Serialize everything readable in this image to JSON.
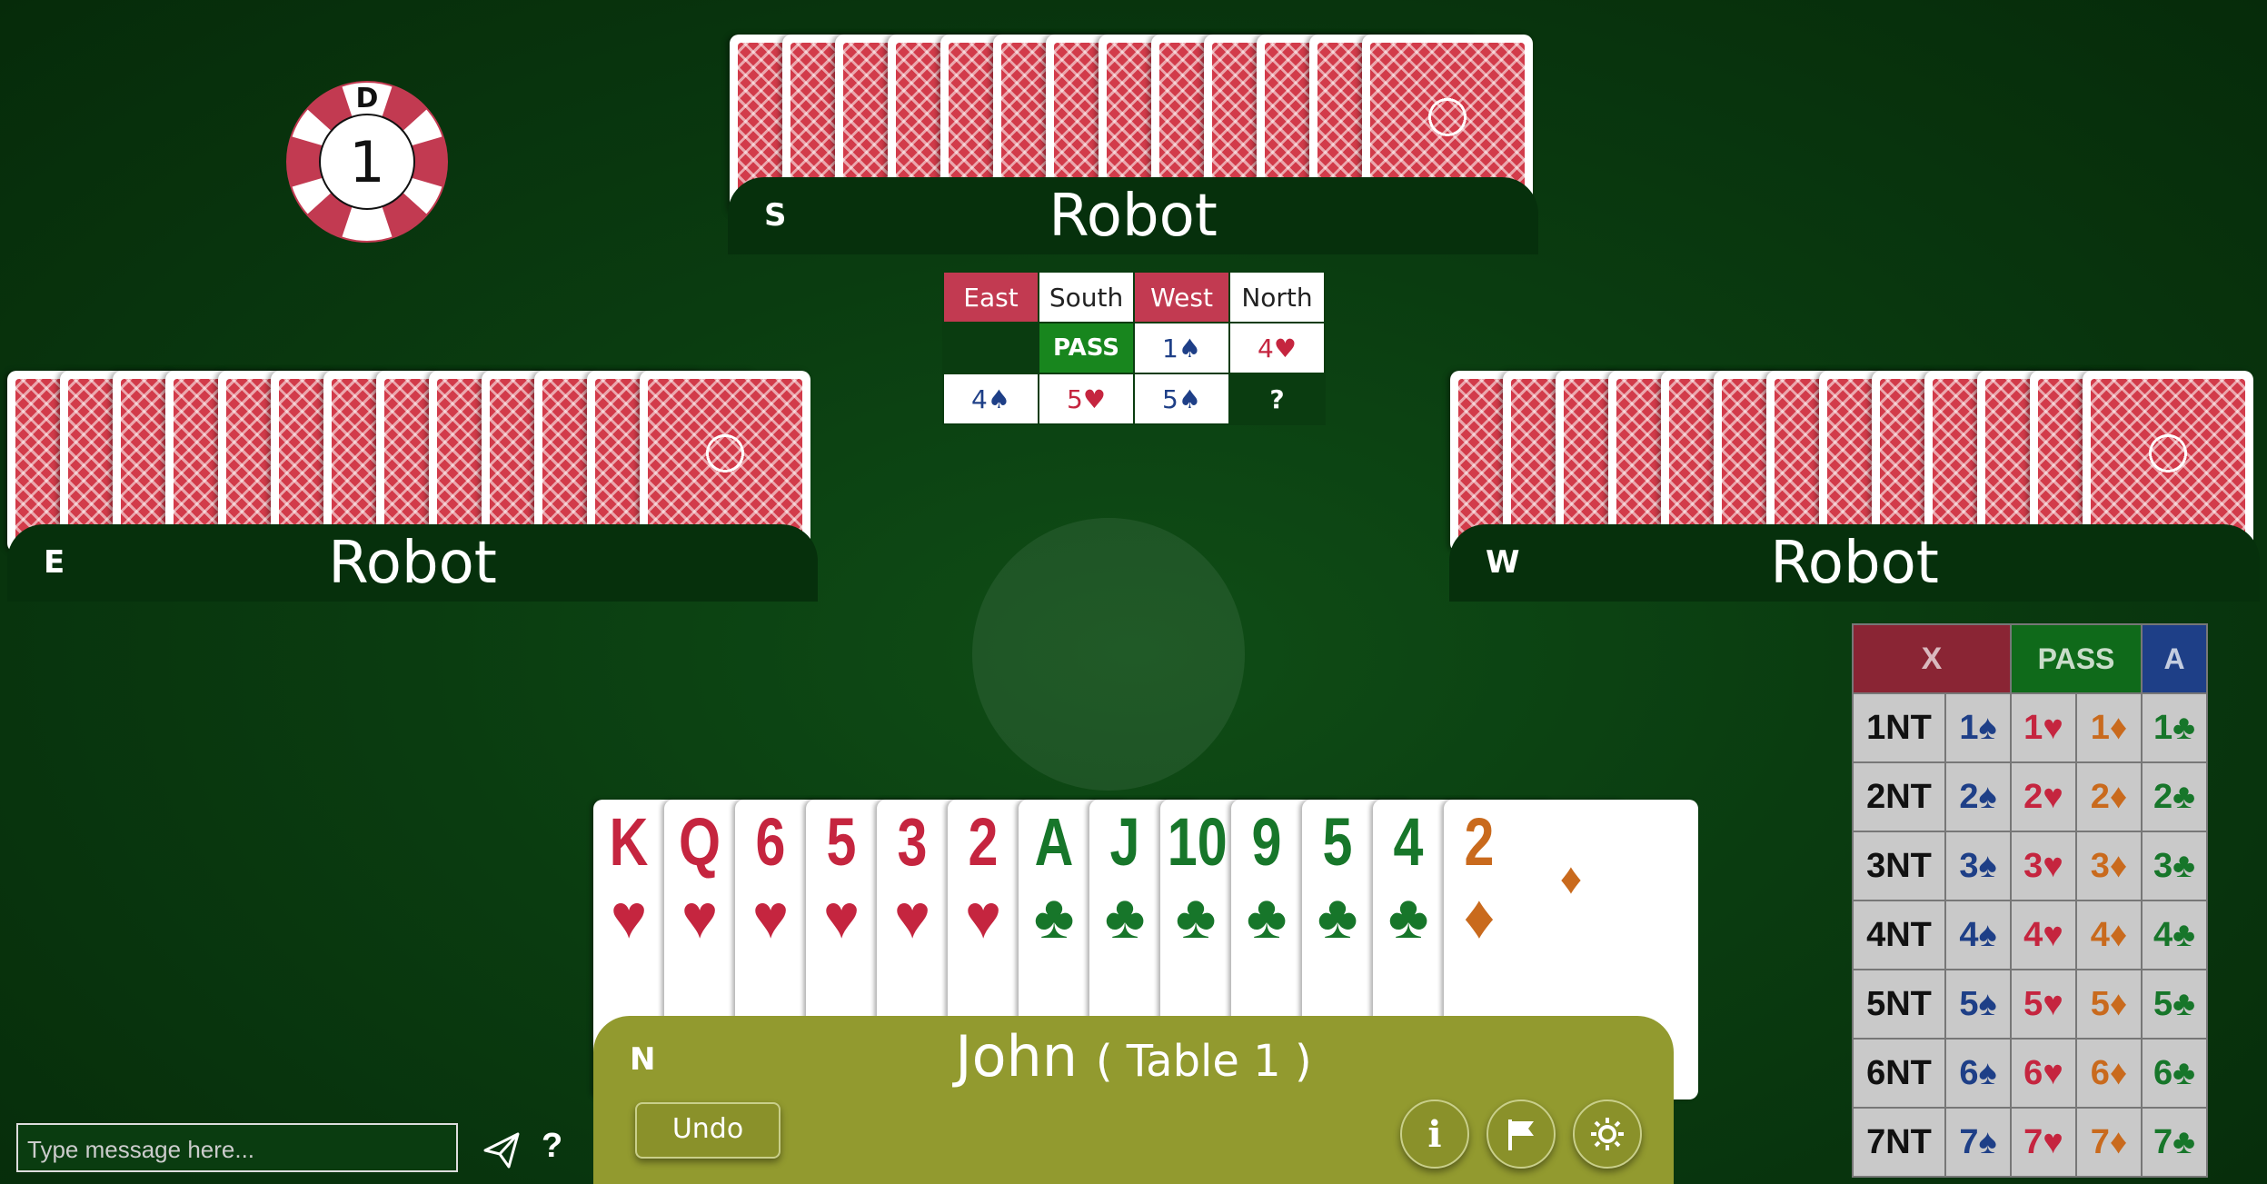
{
  "dealer_marker": {
    "letter": "D",
    "board_number": "1"
  },
  "players": {
    "top": {
      "seat": "S",
      "name": "Robot"
    },
    "left": {
      "seat": "E",
      "name": "Robot"
    },
    "right": {
      "seat": "W",
      "name": "Robot"
    },
    "bottom": {
      "seat": "N",
      "name": "John",
      "table": "( Table 1 )"
    }
  },
  "auction": {
    "headers": [
      "East",
      "South",
      "West",
      "North"
    ],
    "rows": [
      [
        "",
        "PASS",
        "1♠",
        "4♥"
      ],
      [
        "4♠",
        "5♥",
        "5♠",
        "?"
      ]
    ]
  },
  "hand": [
    {
      "rank": "K",
      "suit": "♥"
    },
    {
      "rank": "Q",
      "suit": "♥"
    },
    {
      "rank": "6",
      "suit": "♥"
    },
    {
      "rank": "5",
      "suit": "♥"
    },
    {
      "rank": "3",
      "suit": "♥"
    },
    {
      "rank": "2",
      "suit": "♥"
    },
    {
      "rank": "A",
      "suit": "♣"
    },
    {
      "rank": "J",
      "suit": "♣"
    },
    {
      "rank": "10",
      "suit": "♣"
    },
    {
      "rank": "9",
      "suit": "♣"
    },
    {
      "rank": "5",
      "suit": "♣"
    },
    {
      "rank": "4",
      "suit": "♣"
    },
    {
      "rank": "2",
      "suit": "♦"
    }
  ],
  "buttons": {
    "undo": "Undo",
    "info": "i"
  },
  "bidding_box": {
    "specials": [
      "X",
      "PASS",
      "A"
    ],
    "rows": [
      [
        "1NT",
        "1♠",
        "1♥",
        "1♦",
        "1♣"
      ],
      [
        "2NT",
        "2♠",
        "2♥",
        "2♦",
        "2♣"
      ],
      [
        "3NT",
        "3♠",
        "3♥",
        "3♦",
        "3♣"
      ],
      [
        "4NT",
        "4♠",
        "4♥",
        "4♦",
        "4♣"
      ],
      [
        "5NT",
        "5♠",
        "5♥",
        "5♦",
        "5♣"
      ],
      [
        "6NT",
        "6♠",
        "6♥",
        "6♦",
        "6♣"
      ],
      [
        "7NT",
        "7♠",
        "7♥",
        "7♦",
        "7♣"
      ]
    ]
  },
  "chat": {
    "placeholder": "Type message here...",
    "help": "?"
  },
  "colors": {
    "spade": "#1e3f87",
    "heart": "#c5253f",
    "diamond": "#c96a1d",
    "club": "#17762a",
    "south_bar": "#929a2f",
    "felt": "#0a3c10"
  },
  "icons": [
    "info-icon",
    "flag-icon",
    "gear-icon",
    "send-icon"
  ]
}
